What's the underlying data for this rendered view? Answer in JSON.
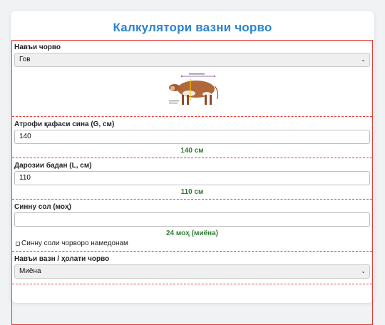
{
  "page": {
    "title": "Калкулятори вазни чорво"
  },
  "animal_type": {
    "label": "Навъи чорво",
    "selected": "Гов",
    "image_alt": "cow-measurement-diagram"
  },
  "chest_girth": {
    "label": "Атрофи қафаси сина (G, см)",
    "value": "140",
    "display": "140 см"
  },
  "body_length": {
    "label": "Дарозии бадан (L, см)",
    "value": "110",
    "display": "110 см"
  },
  "age": {
    "label": "Синну сол (моҳ)",
    "value": "",
    "display": "24 моҳ (миёна)",
    "unknown_checkbox_label": "Синну соли чорворо намедонам",
    "unknown_checked": false
  },
  "condition": {
    "label": "Навъи вазн / ҳолати чорво",
    "selected": "Миёна"
  },
  "colors": {
    "title": "#2b83cd",
    "accent_border": "#e53935",
    "value_text": "#2e7d32"
  }
}
